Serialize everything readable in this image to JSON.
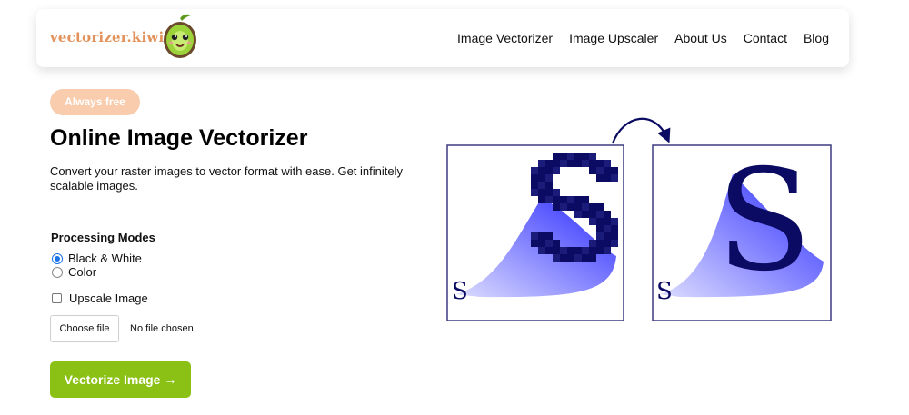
{
  "header": {
    "logo_text": "vectorizer.kiwi",
    "logo_icon": "kiwi-mascot-icon",
    "nav": [
      {
        "label": "Image Vectorizer"
      },
      {
        "label": "Image Upscaler"
      },
      {
        "label": "About Us"
      },
      {
        "label": "Contact"
      },
      {
        "label": "Blog"
      }
    ]
  },
  "hero": {
    "badge": "Always free",
    "title": "Online Image Vectorizer",
    "description": "Convert your raster images to vector format with ease. Get infinitely scalable images."
  },
  "form": {
    "modes_title": "Processing Modes",
    "modes": [
      {
        "label": "Black & White",
        "checked": true
      },
      {
        "label": "Color",
        "checked": false
      }
    ],
    "upscale_label": "Upscale Image",
    "upscale_checked": false,
    "file_button": "Choose file",
    "file_status": "No file chosen",
    "submit": "Vectorize Image →"
  },
  "illustration": {
    "big_letter": "S",
    "small_letter": "S",
    "arrow_icon": "curved-arrow-icon"
  },
  "colors": {
    "accent_green": "#8bc014",
    "badge_peach": "#f8ccad",
    "logo_orange": "#e2925a",
    "navy": "#0b0b63",
    "frame_border": "#3b3b80"
  }
}
